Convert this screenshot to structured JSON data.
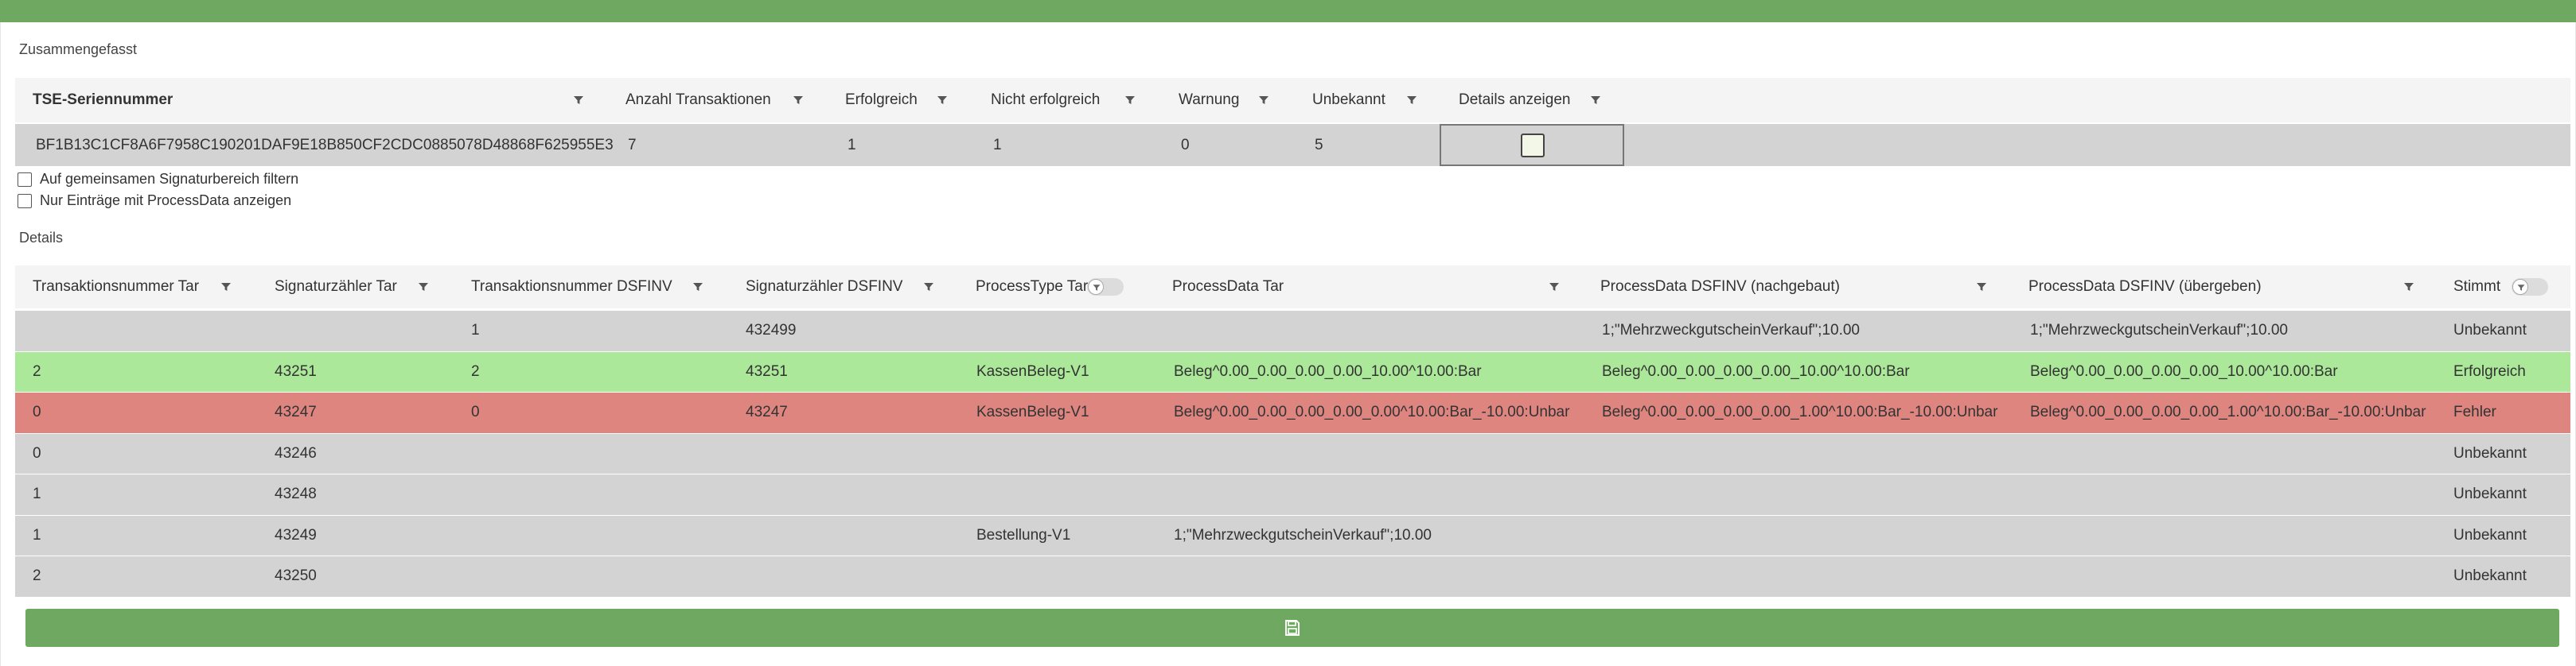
{
  "summary": {
    "title": "Zusammengefasst",
    "columns": [
      "TSE-Seriennummer",
      "Anzahl Transaktionen",
      "Erfolgreich",
      "Nicht erfolgreich",
      "Warnung",
      "Unbekannt",
      "Details anzeigen"
    ],
    "row": {
      "serial": "BF1B13C1CF8A6F7958C190201DAF9E18B850CF2CDC0885078D48868F625955E3",
      "count": "7",
      "success": "1",
      "failed": "1",
      "warning": "0",
      "unknown": "5"
    }
  },
  "options": {
    "filter_signature": "Auf gemeinsamen Signaturbereich filtern",
    "only_processdata": "Nur Einträge mit ProcessData anzeigen"
  },
  "details": {
    "title": "Details",
    "columns": [
      "Transaktionsnummer Tar",
      "Signaturzähler Tar",
      "Transaktionsnummer DSFINV",
      "Signaturzähler DSFINV",
      "ProcessType Tar",
      "ProcessData Tar",
      "ProcessData DSFINV (nachgebaut)",
      "ProcessData DSFINV (übergeben)",
      "Stimmt"
    ],
    "rows": [
      {
        "status": "unknown",
        "cells": [
          "",
          "",
          "1",
          "432499",
          "",
          "",
          "1;\"MehrzweckgutscheinVerkauf\";10.00",
          "1;\"MehrzweckgutscheinVerkauf\";10.00",
          "Unbekannt"
        ]
      },
      {
        "status": "success",
        "cells": [
          "2",
          "43251",
          "2",
          "43251",
          "KassenBeleg-V1",
          "Beleg^0.00_0.00_0.00_0.00_10.00^10.00:Bar",
          "Beleg^0.00_0.00_0.00_0.00_10.00^10.00:Bar",
          "Beleg^0.00_0.00_0.00_0.00_10.00^10.00:Bar",
          "Erfolgreich"
        ]
      },
      {
        "status": "error",
        "cells": [
          "0",
          "43247",
          "0",
          "43247",
          "KassenBeleg-V1",
          "Beleg^0.00_0.00_0.00_0.00_0.00^10.00:Bar_-10.00:Unbar",
          "Beleg^0.00_0.00_0.00_0.00_1.00^10.00:Bar_-10.00:Unbar",
          "Beleg^0.00_0.00_0.00_0.00_1.00^10.00:Bar_-10.00:Unbar",
          "Fehler"
        ]
      },
      {
        "status": "unknown",
        "cells": [
          "0",
          "43246",
          "",
          "",
          "",
          "",
          "",
          "",
          "Unbekannt"
        ]
      },
      {
        "status": "unknown",
        "cells": [
          "1",
          "43248",
          "",
          "",
          "",
          "",
          "",
          "",
          "Unbekannt"
        ]
      },
      {
        "status": "unknown",
        "cells": [
          "1",
          "43249",
          "",
          "",
          "Bestellung-V1",
          "1;\"MehrzweckgutscheinVerkauf\";10.00",
          "",
          "",
          "Unbekannt"
        ]
      },
      {
        "status": "unknown",
        "cells": [
          "2",
          "43250",
          "",
          "",
          "",
          "",
          "",
          "",
          "Unbekannt"
        ]
      }
    ]
  },
  "colors": {
    "accent": "#6fa860",
    "unknown": "#d3d3d3",
    "success": "#ace89a",
    "error": "#de8580"
  },
  "icons": {
    "filter": "filter-icon",
    "toggle": "filter-toggle",
    "save": "save-icon"
  }
}
